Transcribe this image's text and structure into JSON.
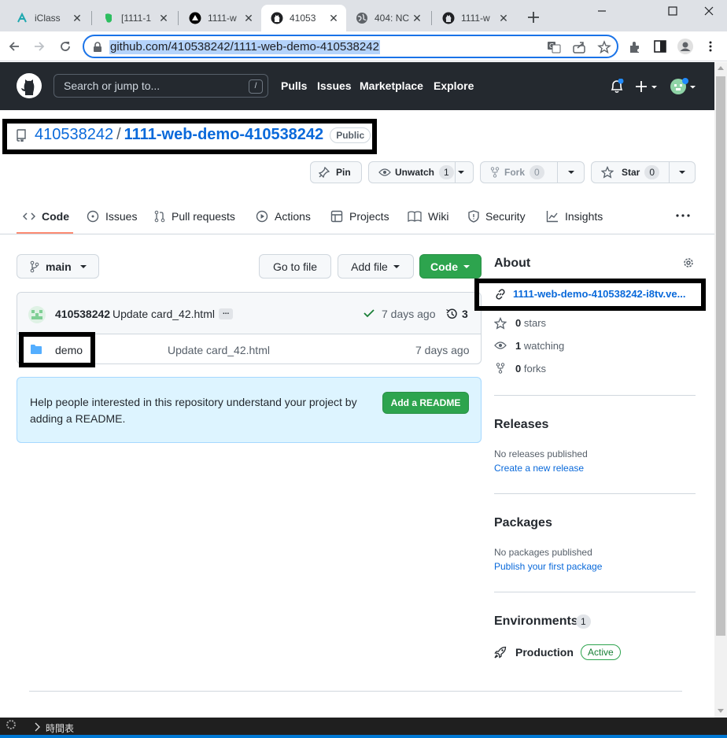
{
  "browser": {
    "tabs": [
      {
        "title": "iClass",
        "icon": "iclass-icon"
      },
      {
        "title": "[1111-1",
        "icon": "evernote-icon"
      },
      {
        "title": "1111-w",
        "icon": "vercel-icon"
      },
      {
        "title": "41053",
        "icon": "github-icon"
      },
      {
        "title": "404: NC",
        "icon": "globe-icon"
      },
      {
        "title": "1111-w",
        "icon": "github-icon"
      }
    ],
    "url": "github.com/410538242/1111-web-demo-410538242"
  },
  "header": {
    "search_placeholder": "Search or jump to...",
    "search_shortcut": "/",
    "nav": [
      "Pulls",
      "Issues",
      "Marketplace",
      "Explore"
    ]
  },
  "repo": {
    "owner": "410538242",
    "separator": "/",
    "name": "1111-web-demo-410538242",
    "visibility": "Public",
    "pin_label": "Pin",
    "watch_label": "Unwatch",
    "watch_count": "1",
    "fork_label": "Fork",
    "fork_count": "0",
    "star_label": "Star",
    "star_count": "0"
  },
  "repo_tabs": [
    "Code",
    "Issues",
    "Pull requests",
    "Actions",
    "Projects",
    "Wiki",
    "Security",
    "Insights"
  ],
  "files": {
    "branch": "main",
    "go_to_file": "Go to file",
    "add_file": "Add file",
    "code_button": "Code",
    "commit_author": "410538242",
    "commit_message": "Update card_42.html",
    "commit_ellipsis": "...",
    "commit_time": "7 days ago",
    "commit_count": "3",
    "rows": [
      {
        "name": "demo",
        "message": "Update card_42.html",
        "time": "7 days ago"
      }
    ]
  },
  "readme": {
    "text": "Help people interested in this repository understand your project by adding a README.",
    "button": "Add a README"
  },
  "about": {
    "title": "About",
    "link": "1111-web-demo-410538242-i8tv.ve...",
    "stars": "0",
    "stars_label": "stars",
    "watching": "1",
    "watching_label": "watching",
    "forks": "0",
    "forks_label": "forks"
  },
  "releases": {
    "title": "Releases",
    "empty": "No releases published",
    "link": "Create a new release"
  },
  "packages": {
    "title": "Packages",
    "empty": "No packages published",
    "link": "Publish your first package"
  },
  "environments": {
    "title": "Environments",
    "count": "1",
    "name": "Production",
    "status": "Active"
  },
  "taskbar": {
    "label": "時間表"
  },
  "colors": {
    "accent": "#0969da",
    "success": "#2da44e",
    "header": "#24292f",
    "tab_underline": "#fd8c73"
  }
}
